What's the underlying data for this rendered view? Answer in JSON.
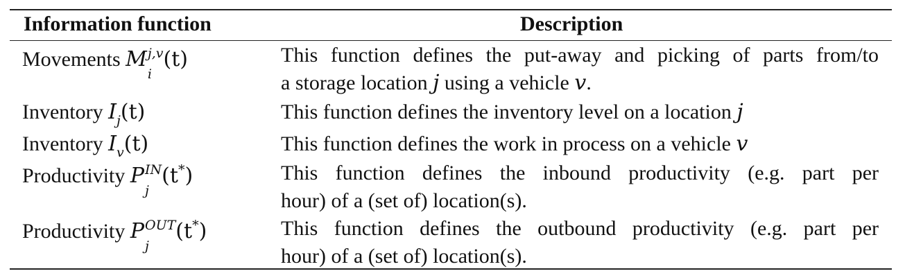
{
  "table": {
    "headers": {
      "col1": "Information function",
      "col2": "Description"
    },
    "rows": [
      {
        "label": "Movements",
        "symbol": "M",
        "sup": "j,v",
        "sub": "i",
        "arg": "(t)",
        "description": [
          "This function defines the put-away and picking of parts from/to",
          "a storage location ",
          "j",
          " using a vehicle ",
          "v",
          "."
        ]
      },
      {
        "label": "Inventory",
        "symbol": "I",
        "sub": "j",
        "arg": "(t)",
        "description": [
          "This function defines the inventory level on a location ",
          "j"
        ]
      },
      {
        "label": "Inventory",
        "symbol": "I",
        "sub": "v",
        "arg": "(t)",
        "description": [
          "This function defines the work in process on a vehicle ",
          "v"
        ]
      },
      {
        "label": "Productivity",
        "symbol": "P",
        "sup": "IN",
        "sub": "j",
        "arg_open": "(t",
        "star": "*",
        "arg_close": ")",
        "description": [
          "This function defines the inbound productivity (e.g. part per",
          "hour) of a (set of) location(s)."
        ]
      },
      {
        "label": "Productivity",
        "symbol": "P",
        "sup": "OUT",
        "sub": "j",
        "arg_open": "(t",
        "star": "*",
        "arg_close": ")",
        "description": [
          "This function defines the outbound productivity (e.g. part per",
          "hour) of a (set of) location(s)."
        ]
      }
    ]
  }
}
